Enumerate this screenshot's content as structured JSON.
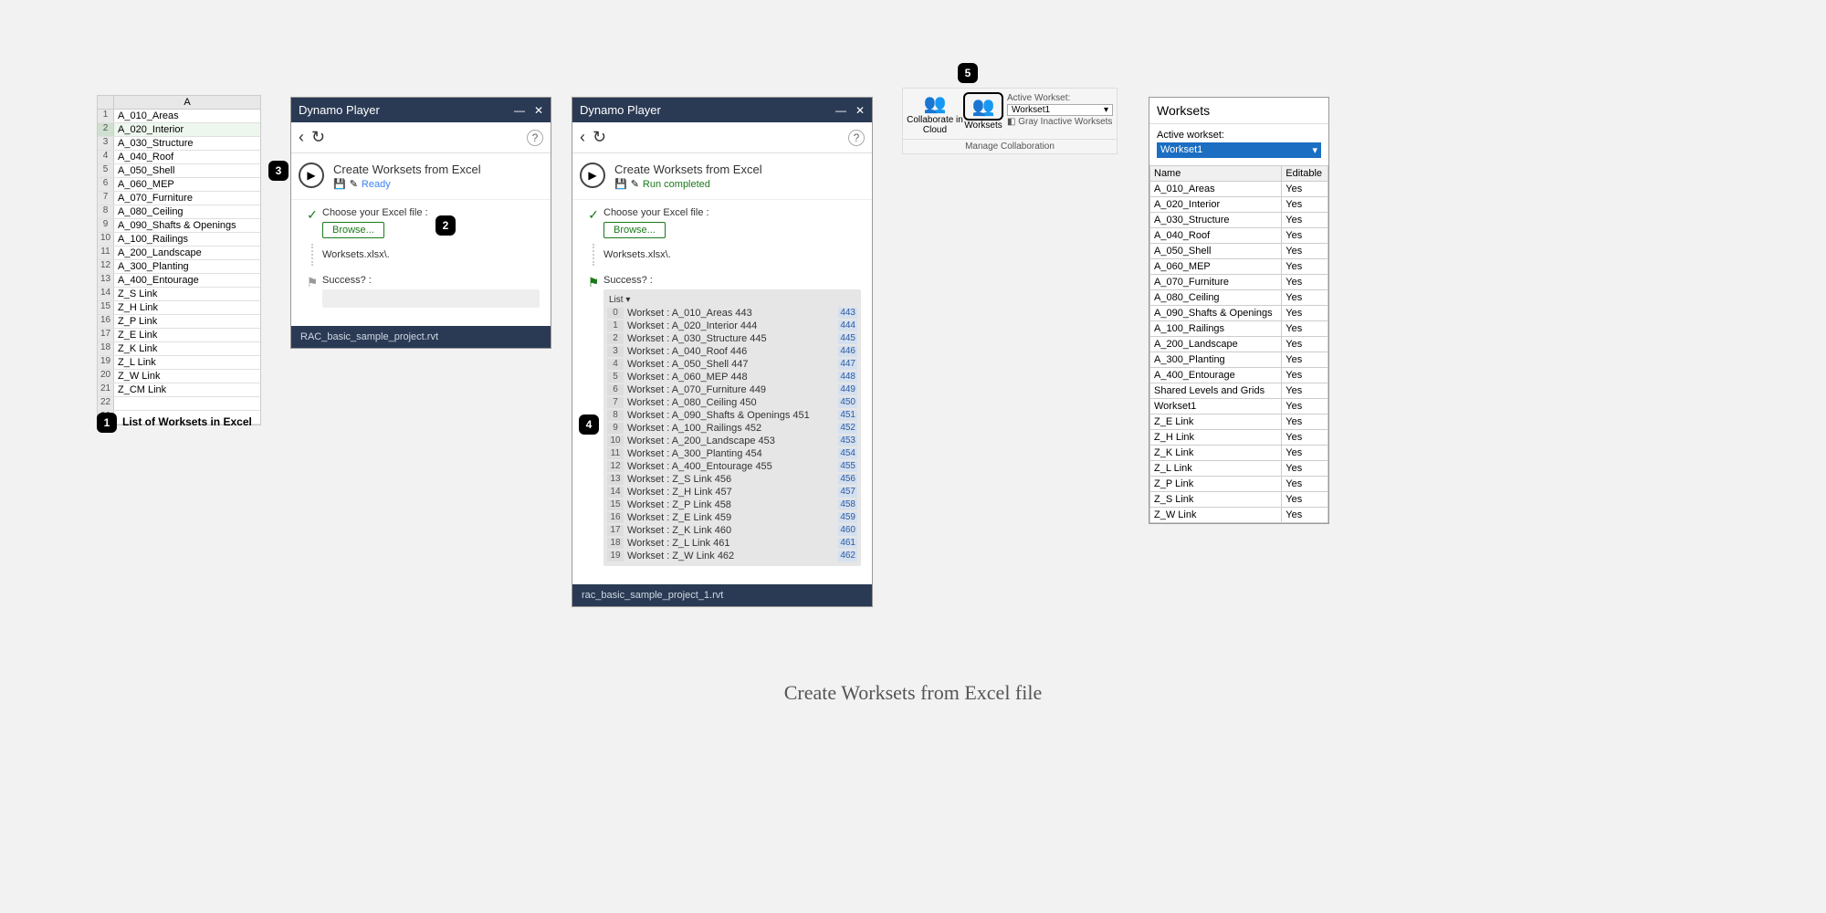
{
  "excel": {
    "column": "A",
    "rows": [
      "A_010_Areas",
      "A_020_Interior",
      "A_030_Structure",
      "A_040_Roof",
      "A_050_Shell",
      "A_060_MEP",
      "A_070_Furniture",
      "A_080_Ceiling",
      "A_090_Shafts & Openings",
      "A_100_Railings",
      "A_200_Landscape",
      "A_300_Planting",
      "A_400_Entourage",
      "Z_S Link",
      "Z_H Link",
      "Z_P Link",
      "Z_E Link",
      "Z_K Link",
      "Z_L Link",
      "Z_W Link",
      "Z_CM Link",
      "",
      ""
    ],
    "selected_row": 1
  },
  "caption1": "List of Worksets in Excel",
  "dyn_common": {
    "title": "Dynamo Player",
    "back_tip": "Back",
    "refresh_tip": "Refresh",
    "help_tip": "?",
    "choose_label": "Choose your Excel file :",
    "browse_label": "Browse...",
    "filename_display": "Worksets.xlsx\\.",
    "success_label": "Success? :"
  },
  "dyn1": {
    "script_name": "Create Worksets from Excel",
    "status_text": "Ready",
    "footer": "RAC_basic_sample_project.rvt"
  },
  "dyn2": {
    "script_name": "Create Worksets from Excel",
    "status_text": "Run completed",
    "list_header": "List ▾",
    "results": [
      {
        "i": 0,
        "name": "A_010_Areas",
        "id1": "443",
        "id2": "443"
      },
      {
        "i": 1,
        "name": "A_020_Interior",
        "id1": "444",
        "id2": "444"
      },
      {
        "i": 2,
        "name": "A_030_Structure",
        "id1": "445",
        "id2": "445"
      },
      {
        "i": 3,
        "name": "A_040_Roof",
        "id1": "446",
        "id2": "446"
      },
      {
        "i": 4,
        "name": "A_050_Shell",
        "id1": "447",
        "id2": "447"
      },
      {
        "i": 5,
        "name": "A_060_MEP",
        "id1": "448",
        "id2": "448"
      },
      {
        "i": 6,
        "name": "A_070_Furniture",
        "id1": "449",
        "id2": "449"
      },
      {
        "i": 7,
        "name": "A_080_Ceiling",
        "id1": "450",
        "id2": "450"
      },
      {
        "i": 8,
        "name": "A_090_Shafts & Openings",
        "id1": "451",
        "id2": "451"
      },
      {
        "i": 9,
        "name": "A_100_Railings",
        "id1": "452",
        "id2": "452"
      },
      {
        "i": 10,
        "name": "A_200_Landscape",
        "id1": "453",
        "id2": "453"
      },
      {
        "i": 11,
        "name": "A_300_Planting",
        "id1": "454",
        "id2": "454"
      },
      {
        "i": 12,
        "name": "A_400_Entourage",
        "id1": "455",
        "id2": "455"
      },
      {
        "i": 13,
        "name": "Z_S Link",
        "id1": "456",
        "id2": "456"
      },
      {
        "i": 14,
        "name": "Z_H Link",
        "id1": "457",
        "id2": "457"
      },
      {
        "i": 15,
        "name": "Z_P Link",
        "id1": "458",
        "id2": "458"
      },
      {
        "i": 16,
        "name": "Z_E Link",
        "id1": "459",
        "id2": "459"
      },
      {
        "i": 17,
        "name": "Z_K Link",
        "id1": "460",
        "id2": "460"
      },
      {
        "i": 18,
        "name": "Z_L Link",
        "id1": "461",
        "id2": "461"
      },
      {
        "i": 19,
        "name": "Z_W Link",
        "id1": "462",
        "id2": "462"
      }
    ],
    "footer": "rac_basic_sample_project_1.rvt"
  },
  "ribbon": {
    "collab_label": "Collaborate in Cloud",
    "worksets_label": "Worksets",
    "active_workset_label": "Active Workset:",
    "active_value": "Workset1",
    "gray_label": "Gray Inactive Worksets",
    "panel_label": "Manage Collaboration"
  },
  "wsd": {
    "title": "Worksets",
    "aw_label": "Active workset:",
    "aw_value": "Workset1",
    "cols": {
      "name": "Name",
      "editable": "Editable"
    },
    "rows": [
      {
        "n": "A_010_Areas",
        "e": "Yes"
      },
      {
        "n": "A_020_Interior",
        "e": "Yes"
      },
      {
        "n": "A_030_Structure",
        "e": "Yes"
      },
      {
        "n": "A_040_Roof",
        "e": "Yes"
      },
      {
        "n": "A_050_Shell",
        "e": "Yes"
      },
      {
        "n": "A_060_MEP",
        "e": "Yes"
      },
      {
        "n": "A_070_Furniture",
        "e": "Yes"
      },
      {
        "n": "A_080_Ceiling",
        "e": "Yes"
      },
      {
        "n": "A_090_Shafts & Openings",
        "e": "Yes"
      },
      {
        "n": "A_100_Railings",
        "e": "Yes"
      },
      {
        "n": "A_200_Landscape",
        "e": "Yes"
      },
      {
        "n": "A_300_Planting",
        "e": "Yes"
      },
      {
        "n": "A_400_Entourage",
        "e": "Yes"
      },
      {
        "n": "Shared Levels and Grids",
        "e": "Yes"
      },
      {
        "n": "Workset1",
        "e": "Yes"
      },
      {
        "n": "Z_E Link",
        "e": "Yes"
      },
      {
        "n": "Z_H Link",
        "e": "Yes"
      },
      {
        "n": "Z_K Link",
        "e": "Yes"
      },
      {
        "n": "Z_L Link",
        "e": "Yes"
      },
      {
        "n": "Z_P Link",
        "e": "Yes"
      },
      {
        "n": "Z_S Link",
        "e": "Yes"
      },
      {
        "n": "Z_W Link",
        "e": "Yes"
      }
    ]
  },
  "badges": {
    "b1": "1",
    "b2": "2",
    "b3": "3",
    "b4": "4",
    "b5": "5"
  },
  "main_caption": "Create Worksets from Excel file"
}
